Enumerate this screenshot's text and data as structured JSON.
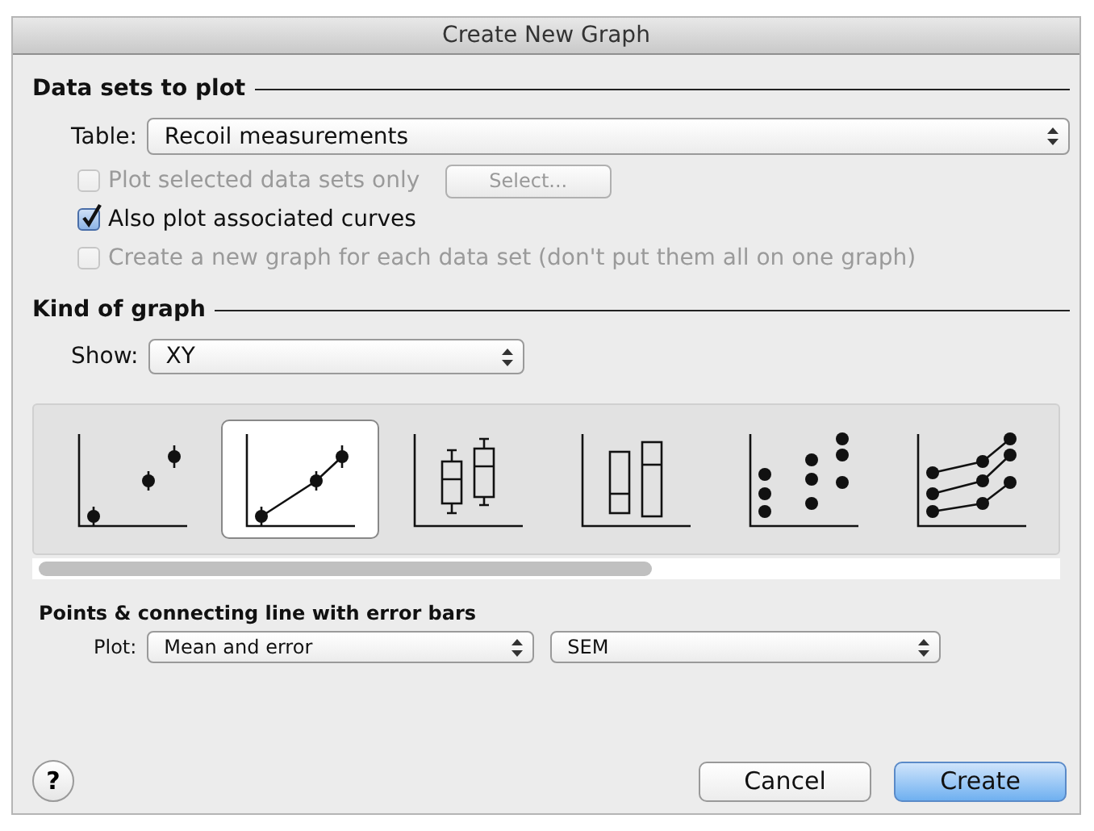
{
  "window": {
    "title": "Create New Graph"
  },
  "data_sets": {
    "heading": "Data sets to plot",
    "table_label": "Table:",
    "table_value": "Recoil measurements",
    "select_button": {
      "label": "Select...",
      "disabled": true
    },
    "options": [
      {
        "label": "Plot selected data sets only",
        "checked": false,
        "disabled": true
      },
      {
        "label": "Also plot associated curves",
        "checked": true,
        "disabled": false
      },
      {
        "label": "Create a new graph for each data set (don't put them all on one graph)",
        "checked": false,
        "disabled": true
      }
    ]
  },
  "kind_of_graph": {
    "heading": "Kind of graph",
    "show_label": "Show:",
    "show_value": "XY",
    "graph_types": [
      {
        "kind": "points",
        "selected": false
      },
      {
        "kind": "line",
        "selected": true
      },
      {
        "kind": "box",
        "selected": false
      },
      {
        "kind": "bars",
        "selected": false
      },
      {
        "kind": "dots",
        "selected": false
      },
      {
        "kind": "lines",
        "selected": false
      }
    ]
  },
  "graph_options": {
    "heading": "Points & connecting line with error bars",
    "plot_label": "Plot:",
    "plot_value": "Mean and error",
    "error_value": "SEM"
  },
  "buttons": [
    {
      "kind": "help",
      "label": "?"
    },
    {
      "kind": "cancel",
      "label": "Cancel"
    },
    {
      "kind": "default",
      "label": "Create"
    }
  ]
}
